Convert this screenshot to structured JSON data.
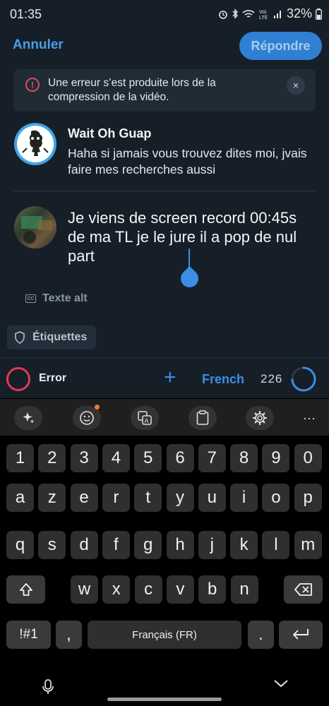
{
  "status_bar": {
    "time": "01:35",
    "battery": "32%",
    "icons": [
      "alarm-icon",
      "bluetooth-icon",
      "wifi-icon",
      "volte-icon",
      "signal-icon",
      "battery-icon"
    ]
  },
  "top_bar": {
    "cancel": "Annuler",
    "reply": "Répondre"
  },
  "error_banner": {
    "icon": "!",
    "message": "Une erreur s’est produite lors de la compression de la vidéo.",
    "close": "×"
  },
  "quoted_post": {
    "author": "Wait Oh Guap",
    "text": "Haha si jamais vous trouvez dites moi, jvais faire mes recherches aussi"
  },
  "compose": {
    "text": "Je viens de screen record 00:45s de ma TL je le jure il a pop de nul part",
    "alt_text": "Texte alt",
    "alt_icon": "CC",
    "labels": "Étiquettes"
  },
  "compose_bar": {
    "status": "Error",
    "add": "+",
    "language": "French",
    "char_count": "226",
    "progress": 0.74,
    "colors": {
      "error": "#e2395a",
      "accent": "#3a8ee6"
    }
  },
  "keyboard": {
    "toolbar": [
      "sparkle-icon",
      "emoji-icon",
      "translate-icon",
      "clipboard-icon",
      "settings-icon",
      "more-icon"
    ],
    "more": "···",
    "row_numbers": [
      "1",
      "2",
      "3",
      "4",
      "5",
      "6",
      "7",
      "8",
      "9",
      "0"
    ],
    "row1": [
      "a",
      "z",
      "e",
      "r",
      "t",
      "y",
      "u",
      "i",
      "o",
      "p"
    ],
    "row2": [
      "q",
      "s",
      "d",
      "f",
      "g",
      "h",
      "j",
      "k",
      "l",
      "m"
    ],
    "row3": [
      "w",
      "x",
      "c",
      "v",
      "b",
      "n"
    ],
    "symbols": "!#1",
    "comma": ",",
    "space": "Français (FR)",
    "period": "."
  }
}
